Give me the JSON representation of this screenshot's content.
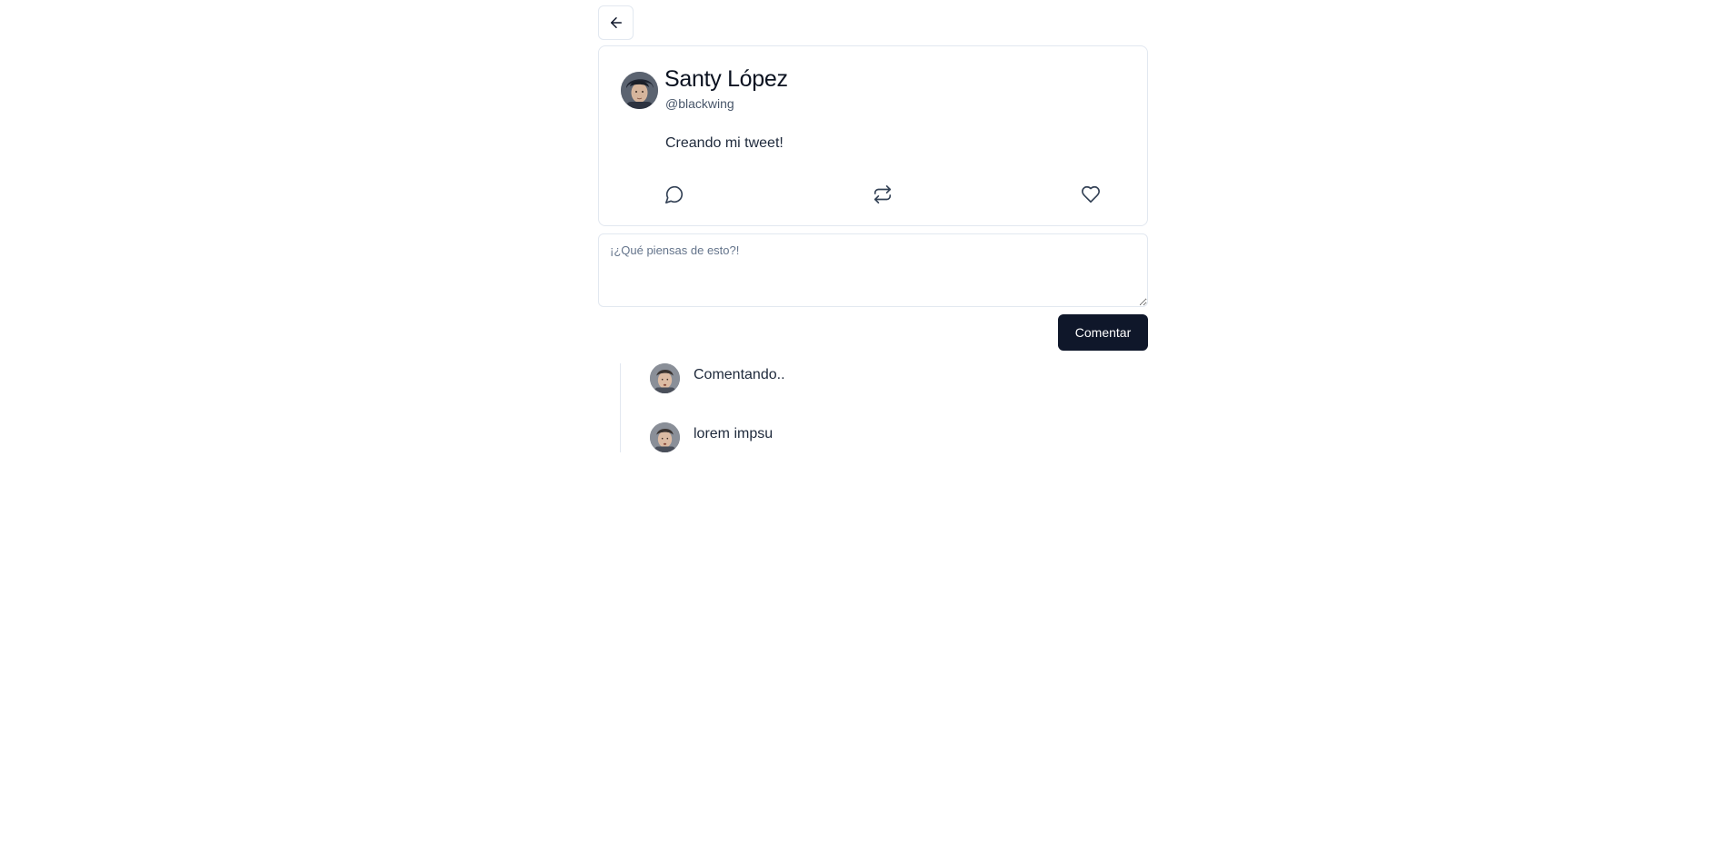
{
  "back_button": {
    "icon": "arrow-left-icon"
  },
  "tweet": {
    "author_name": "Santy López",
    "author_handle": "@blackwing",
    "avatar": "avatar-photo",
    "text": "Creando mi tweet!",
    "actions": [
      {
        "icon": "comment-icon"
      },
      {
        "icon": "retweet-icon"
      },
      {
        "icon": "heart-icon"
      }
    ]
  },
  "comment_form": {
    "placeholder": "¡¿Qué piensas de esto?!",
    "value": "",
    "submit_label": "Comentar"
  },
  "comments": [
    {
      "text": "Comentando..",
      "avatar": "avatar-photo"
    },
    {
      "text": "lorem impsu",
      "avatar": "avatar-photo"
    }
  ],
  "colors": {
    "primary_button": "#0f172a",
    "border": "#e2e8f0",
    "muted_text": "#475569"
  }
}
